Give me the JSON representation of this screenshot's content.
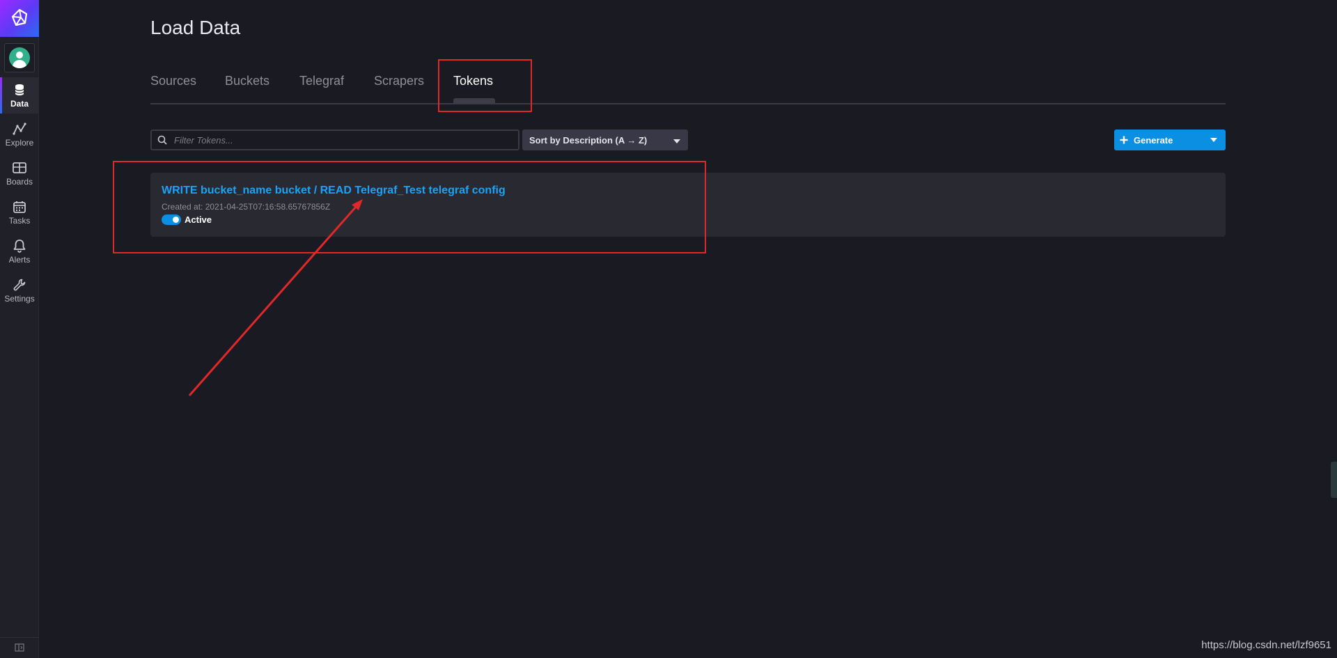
{
  "sidebar": {
    "logo_icon": "influxdb-cube-icon",
    "user_icon": "user-avatar-icon",
    "items": [
      {
        "label": "Data",
        "icon": "database-icon",
        "active": true
      },
      {
        "label": "Explore",
        "icon": "graph-line-icon",
        "active": false
      },
      {
        "label": "Boards",
        "icon": "dashboard-grid-icon",
        "active": false
      },
      {
        "label": "Tasks",
        "icon": "calendar-icon",
        "active": false
      },
      {
        "label": "Alerts",
        "icon": "bell-icon",
        "active": false
      },
      {
        "label": "Settings",
        "icon": "wrench-icon",
        "active": false
      }
    ],
    "collapse_icon": "sidebar-collapse-icon"
  },
  "page": {
    "title": "Load Data"
  },
  "tabs": [
    {
      "label": "Sources",
      "active": false
    },
    {
      "label": "Buckets",
      "active": false
    },
    {
      "label": "Telegraf",
      "active": false
    },
    {
      "label": "Scrapers",
      "active": false
    },
    {
      "label": "Tokens",
      "active": true
    }
  ],
  "toolbar": {
    "search_placeholder": "Filter Tokens...",
    "search_value": "",
    "sort_label": "Sort by Description (A → Z)",
    "generate_label": "Generate"
  },
  "tokens": [
    {
      "description": "WRITE bucket_name bucket / READ Telegraf_Test telegraf config",
      "created_at": "Created at: 2021-04-25T07:16:58.65767856Z",
      "status_label": "Active",
      "active": true
    }
  ],
  "watermark": "https://blog.csdn.net/lzf9651",
  "colors": {
    "accent_blue": "#0b8fe3",
    "link_blue": "#1da3f5",
    "annotation_red": "#e02828",
    "background": "#1a1a22"
  }
}
